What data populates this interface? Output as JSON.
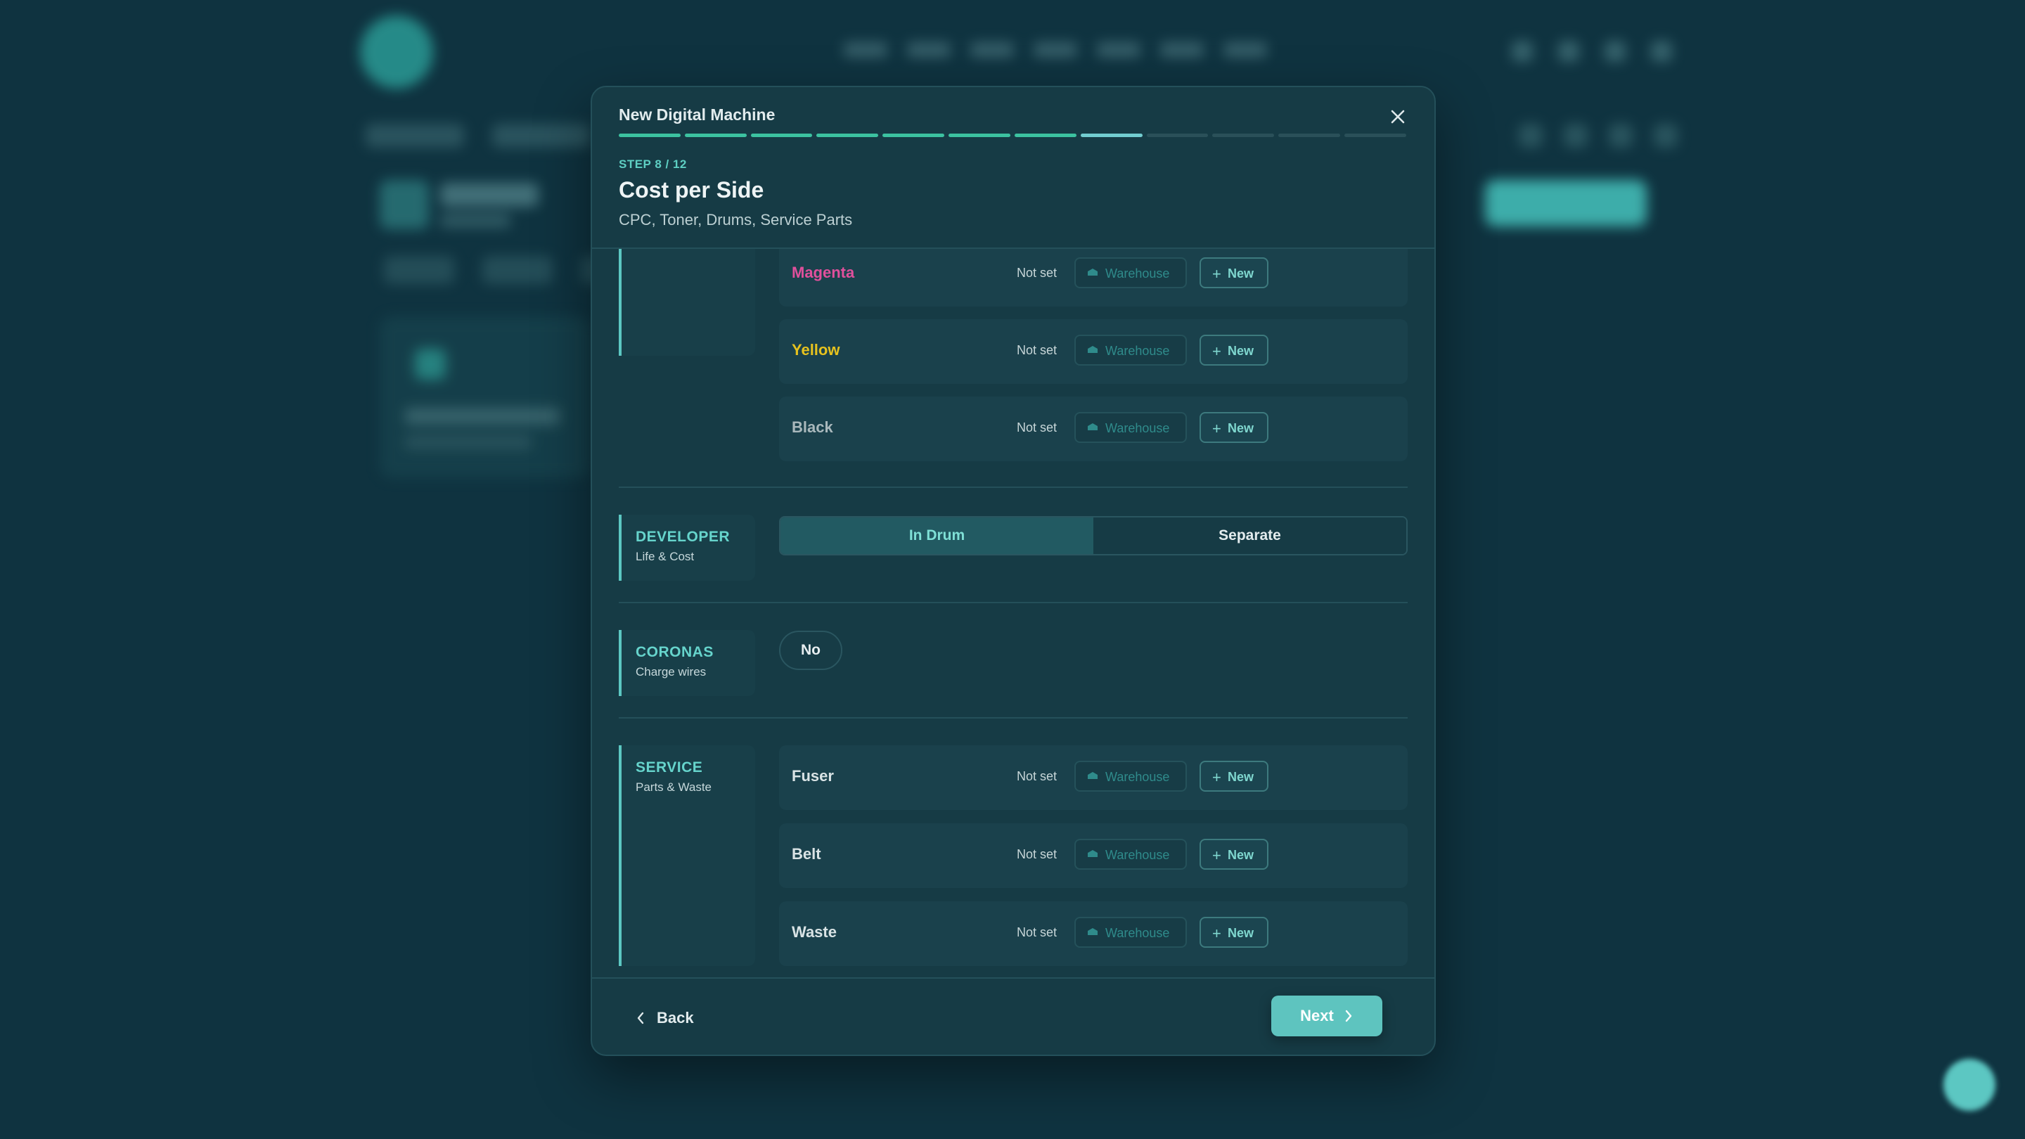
{
  "modal": {
    "title": "New Digital Machine",
    "progress": {
      "current_step": 8,
      "total_steps": 12
    },
    "step_label": "STEP 8 / 12",
    "step_title": "Cost per Side",
    "step_subtitle": "CPC, Toner, Drums, Service Parts"
  },
  "toner_rows": [
    {
      "label": "Magenta",
      "color": "#e0509c",
      "status": "Not set",
      "warehouse": "Warehouse",
      "new": "New"
    },
    {
      "label": "Yellow",
      "color": "#e6c21e",
      "status": "Not set",
      "warehouse": "Warehouse",
      "new": "New"
    },
    {
      "label": "Black",
      "color": "#a9b8bc",
      "status": "Not set",
      "warehouse": "Warehouse",
      "new": "New"
    }
  ],
  "developer": {
    "name": "DEVELOPER",
    "desc": "Life & Cost",
    "options": [
      "In Drum",
      "Separate"
    ],
    "selected": "In Drum"
  },
  "coronas": {
    "name": "CORONAS",
    "desc": "Charge wires",
    "value": "No"
  },
  "service": {
    "name": "SERVICE",
    "desc": "Parts & Waste",
    "rows": [
      {
        "label": "Fuser",
        "color": "#d9e3e5",
        "status": "Not set",
        "warehouse": "Warehouse",
        "new": "New"
      },
      {
        "label": "Belt",
        "color": "#d9e3e5",
        "status": "Not set",
        "warehouse": "Warehouse",
        "new": "New"
      },
      {
        "label": "Waste",
        "color": "#d9e3e5",
        "status": "Not set",
        "warehouse": "Warehouse",
        "new": "New"
      }
    ]
  },
  "footer": {
    "back": "Back",
    "next": "Next"
  },
  "colors": {
    "accent": "#5cc7c2",
    "progress_done": "#3cc2a0",
    "progress_current": "#72cdd0"
  }
}
